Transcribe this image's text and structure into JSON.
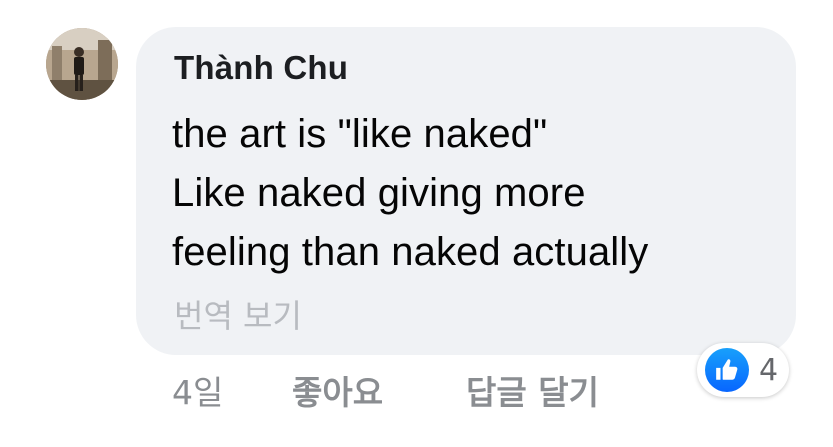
{
  "comment": {
    "author": "Thành Chu",
    "lines": [
      "the art is \"like naked\"",
      "Like naked giving more",
      "feeling than naked actually"
    ],
    "see_translation": "번역 보기"
  },
  "actions": {
    "time": "4일",
    "like": "좋아요",
    "reply": "답글 달기"
  },
  "reactions": {
    "icon": "thumbs-up-icon",
    "count": "4",
    "color": "#1877f2"
  },
  "colors": {
    "bubble": "#f0f2f5",
    "muted": "#8a8d91",
    "text": "#050505"
  }
}
